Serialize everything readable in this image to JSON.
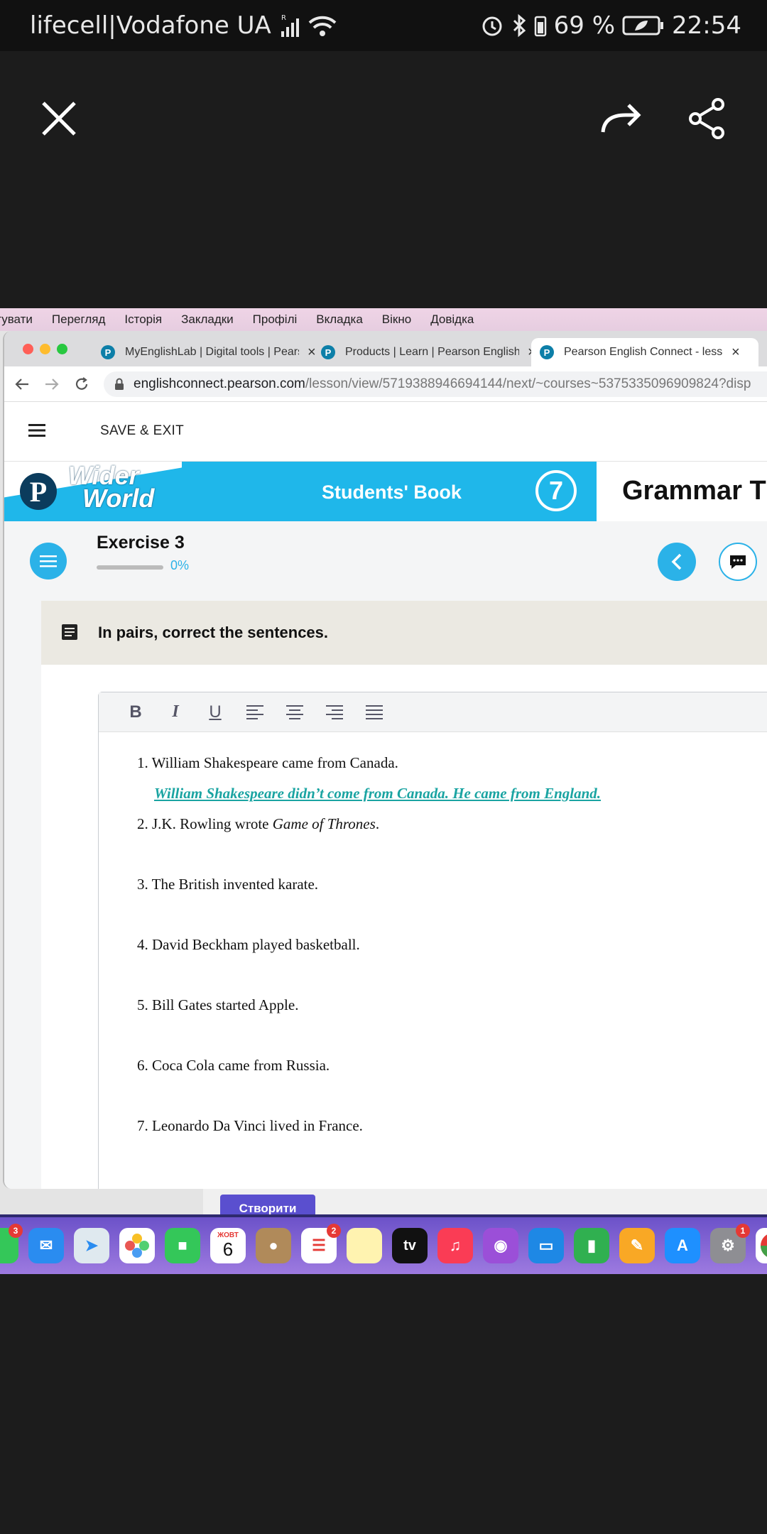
{
  "statusbar": {
    "carrier": "lifecell|Vodafone UA",
    "battery": "69 %",
    "time": "22:54"
  },
  "menubar": [
    "гувати",
    "Перегляд",
    "Історія",
    "Закладки",
    "Профілі",
    "Вкладка",
    "Вікно",
    "Довідка"
  ],
  "tabs": [
    {
      "title": "MyEnglishLab | Digital tools | Pearson"
    },
    {
      "title": "Products | Learn | Pearson English"
    },
    {
      "title": "Pearson English Connect - lesson"
    }
  ],
  "address": {
    "host": "englishconnect.pearson.com",
    "path": "/lesson/view/5719388946694144/next/~courses~5375335096909824?disp"
  },
  "appbar": {
    "save_exit": "SAVE & EXIT"
  },
  "banner": {
    "logo_letter": "P",
    "brand_line1": "Wider",
    "brand_line2": "World",
    "book": "Students' Book",
    "level": "7",
    "section": "Grammar Tim"
  },
  "exercise": {
    "title": "Exercise 3",
    "progress_text": "0%",
    "progress_value": 0,
    "instruction": "In pairs, correct the sentences."
  },
  "toolbar": {
    "bold": "B",
    "italic": "I",
    "underline": "U"
  },
  "sentences": [
    {
      "n": "1.",
      "text": "William Shakespeare came from Canada.",
      "answer": "William Shakespeare didn’t come from Canada. He came from England."
    },
    {
      "n": "2.",
      "pre": "J.K. Rowling wrote ",
      "em": "Game of Thrones",
      "post": ".",
      "answer": ""
    },
    {
      "n": "3.",
      "text": "The British invented karate.",
      "answer": ""
    },
    {
      "n": "4.",
      "text": "David Beckham played basketball.",
      "answer": ""
    },
    {
      "n": "5.",
      "text": "Bill Gates started Apple.",
      "answer": ""
    },
    {
      "n": "6.",
      "text": "Coca Cola came from Russia.",
      "answer": ""
    },
    {
      "n": "7.",
      "text": "Leonardo Da Vinci lived in France.",
      "answer": ""
    }
  ],
  "behind": {
    "create_button": "Створити"
  },
  "dock": {
    "calendar_month": "ЖОВТ",
    "calendar_day": "6",
    "tv_label": "tv",
    "badges": {
      "messages": "3",
      "reminders": "2",
      "settings": "1"
    }
  },
  "colors": {
    "accent": "#2bb2e8",
    "answer": "#1aa4a2",
    "banner": "#1fb7ea",
    "create": "#5a4fcf"
  }
}
